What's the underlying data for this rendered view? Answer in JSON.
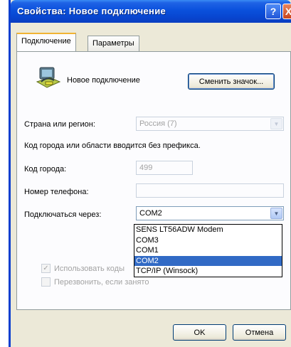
{
  "window": {
    "title": "Свойства: Новое подключение",
    "help_glyph": "?",
    "close_glyph": "X"
  },
  "tabs": [
    {
      "label": "Подключение",
      "active": true
    },
    {
      "label": "Параметры",
      "active": false
    }
  ],
  "connection": {
    "name": "Новое подключение",
    "icon": "modem-phone-icon",
    "change_icon_label": "Сменить значок..."
  },
  "form": {
    "country_label": "Страна или регион:",
    "country_value": "Россия (7)",
    "hint": "Код города или области вводится без префикса.",
    "area_code_label": "Код города:",
    "area_code_value": "499",
    "phone_label": "Номер телефона:",
    "phone_value": "",
    "connect_via_label": "Подключаться через:",
    "connect_via_value": "COM2"
  },
  "dropdown_options": [
    {
      "label": "SENS LT56ADW Modem",
      "selected": false
    },
    {
      "label": "COM3",
      "selected": false
    },
    {
      "label": "COM1",
      "selected": false
    },
    {
      "label": "COM2",
      "selected": true
    },
    {
      "label": "TCP/IP (Winsock)",
      "selected": false
    }
  ],
  "checkboxes": {
    "use_codes_label": "Использовать коды",
    "use_codes_checked": true,
    "redial_label": "Перезвонить, если занято",
    "redial_checked": false
  },
  "buttons": {
    "ok_label": "OK",
    "cancel_label": "Отмена"
  },
  "colors": {
    "titlebar": "#0a50dc",
    "selection": "#316ac5",
    "face": "#ece9d8"
  }
}
